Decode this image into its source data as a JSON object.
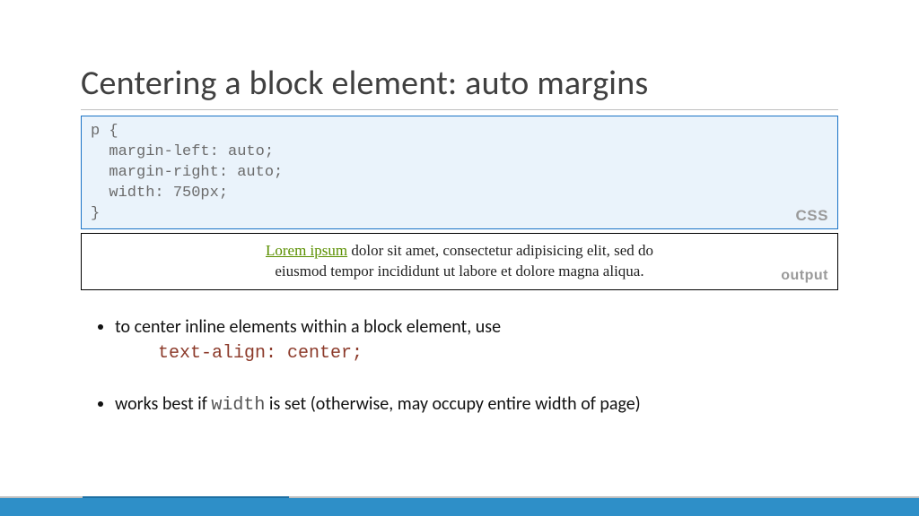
{
  "title": "Centering a block element: auto margins",
  "code_block": {
    "content": "p {\n  margin-left: auto;\n  margin-right: auto;\n  width: 750px;\n}",
    "badge": "CSS"
  },
  "output_block": {
    "link_text": "Lorem ipsum",
    "line1_rest": " dolor sit amet, consectetur adipisicing elit, sed do",
    "line2": "eiusmod tempor incididunt ut labore et dolore magna aliqua.",
    "badge": "output"
  },
  "bullets": [
    {
      "text": "to center inline elements within a block element, use",
      "subline_code": "text-align: center;"
    },
    {
      "before": "works best if ",
      "code": "width",
      "after": " is set (otherwise, may occupy entire width of page)"
    }
  ]
}
